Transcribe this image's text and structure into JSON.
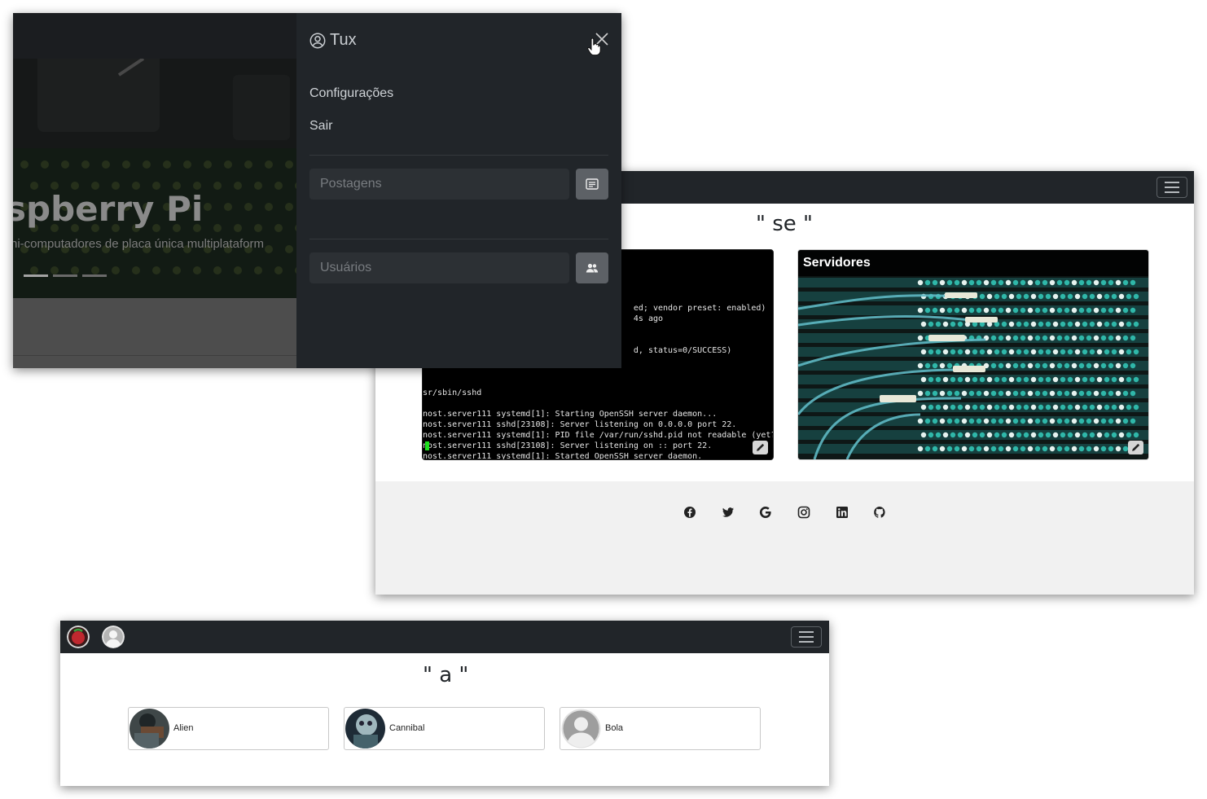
{
  "menu_window": {
    "hero": {
      "title": "spberry Pi",
      "subtitle": "ni-computadores de placa única multiplataform",
      "indicators": [
        true,
        false,
        false
      ]
    },
    "offcanvas": {
      "user_name": "Tux",
      "links": [
        "Configurações",
        "Sair"
      ],
      "posts_search": {
        "placeholder": "Postagens",
        "value": ""
      },
      "users_search": {
        "placeholder": "Usuários",
        "value": ""
      }
    }
  },
  "posts_window": {
    "query_text": "\" se \"",
    "terminal": {
      "lines": [
        "",
        "",
        "",
        "",
        "",
        "                                           ed; vendor preset: enabled)",
        "                                           4s ago",
        "",
        "",
        "                                           d, status=0/SUCCESS)",
        "",
        "",
        "",
        "sr/sbin/sshd",
        "",
        "nost.server111 systemd[1]: Starting OpenSSH server daemon...",
        "nost.server111 sshd[23108]: Server listening on 0.0.0.0 port 22.",
        "nost.server111 systemd[1]: PID file /var/run/sshd.pid not readable (yet?",
        "nost.server111 sshd[23108]: Server listening on :: port 22.",
        "nost.server111 systemd[1]: Started OpenSSH server daemon."
      ]
    },
    "servers_card": {
      "title": "Servidores"
    },
    "footer_icons": [
      "facebook-icon",
      "twitter-icon",
      "google-icon",
      "instagram-icon",
      "linkedin-icon",
      "github-icon"
    ]
  },
  "users_window": {
    "query_text": "\" a \"",
    "users": [
      {
        "name": "Alien"
      },
      {
        "name": "Cannibal"
      },
      {
        "name": "Bola"
      }
    ]
  },
  "colors": {
    "navbar": "#212529",
    "offcanvas": "#212529",
    "footer": "#f1f1f1",
    "terminal_cursor": "#1ee01e"
  }
}
